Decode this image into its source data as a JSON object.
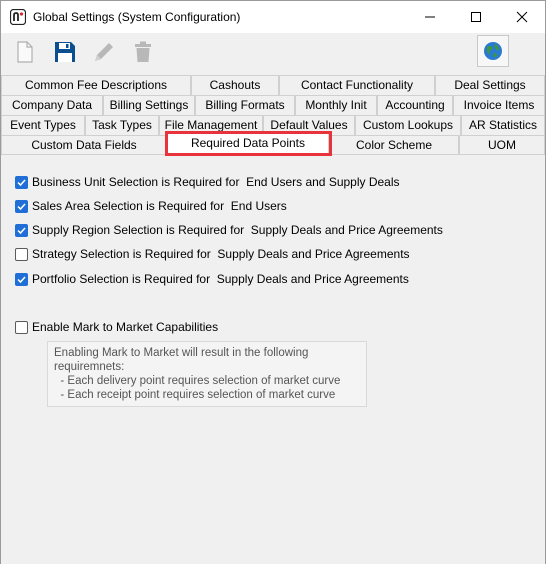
{
  "window": {
    "title": "Global Settings (System Configuration)"
  },
  "tabs": {
    "row1": [
      "Common Fee Descriptions",
      "Cashouts",
      "Contact Functionality",
      "Deal Settings"
    ],
    "row2": [
      "Company Data",
      "Billing Settings",
      "Billing Formats",
      "Monthly Init",
      "Accounting",
      "Invoice Items"
    ],
    "row3": [
      "Event Types",
      "Task Types",
      "File Management",
      "Default Values",
      "Custom Lookups",
      "AR Statistics"
    ],
    "row4": [
      "Custom Data Fields",
      "Required Data Points",
      "Color Scheme",
      "UOM"
    ],
    "active": "Required Data Points"
  },
  "required_points": [
    {
      "label": "Business Unit Selection is Required for  End Users and Supply Deals",
      "checked": true
    },
    {
      "label": "Sales Area Selection is Required for  End Users",
      "checked": true
    },
    {
      "label": "Supply Region Selection is Required for  Supply Deals and Price Agreements",
      "checked": true
    },
    {
      "label": "Strategy Selection is Required for  Supply Deals and Price Agreements",
      "checked": false
    },
    {
      "label": "Portfolio Selection is Required for  Supply Deals and Price Agreements",
      "checked": true
    }
  ],
  "mark_to_market": {
    "label": "Enable Mark to Market Capabilities",
    "checked": false,
    "note_lines": [
      "Enabling Mark to Market will result in the following",
      "requiremnets:",
      "  - Each delivery point requires selection of market curve",
      "  - Each receipt point requires selection of market curve"
    ]
  },
  "colors": {
    "checkbox_checked": "#1f6fd6",
    "highlight": "#e8323c"
  }
}
